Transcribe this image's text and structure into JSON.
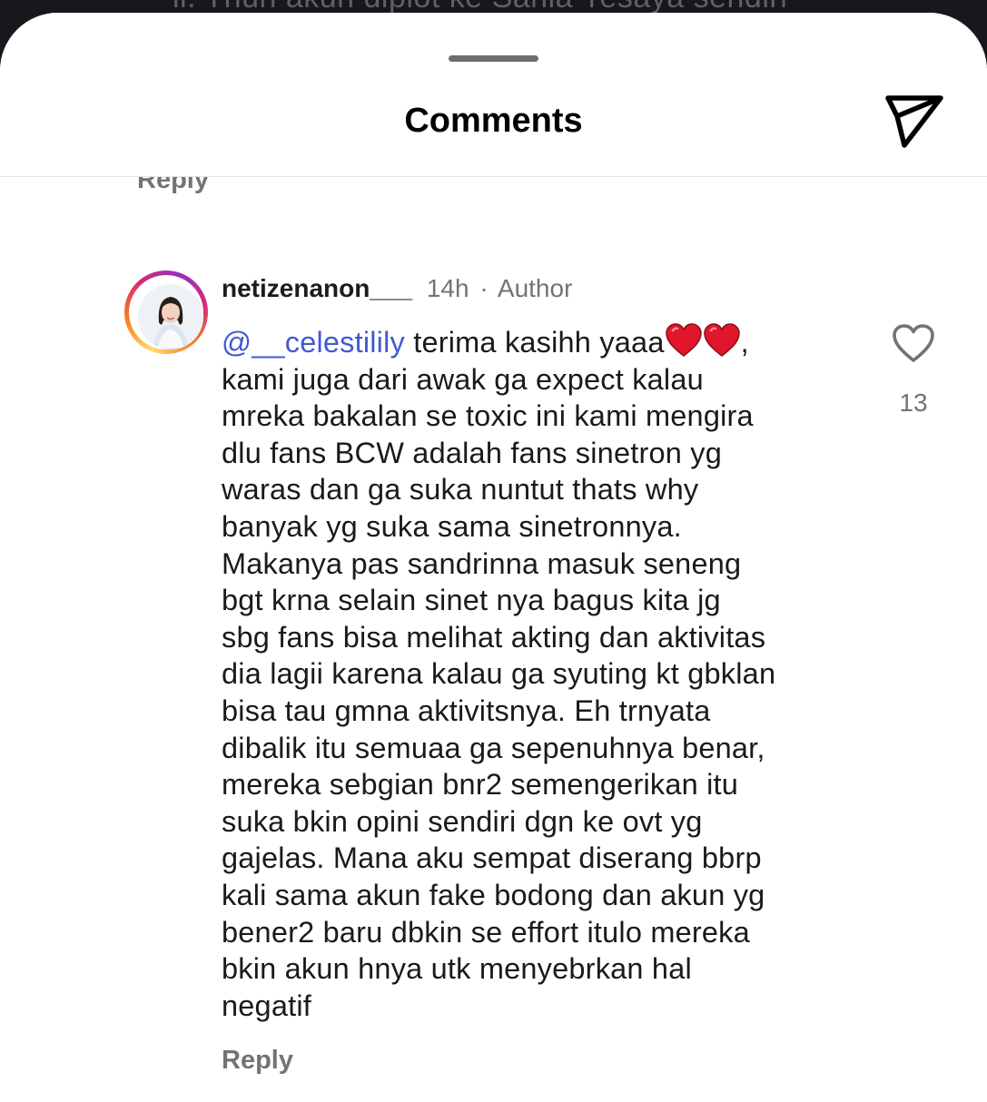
{
  "background": {
    "partial_text": "ii. Thun akun diplot ke Sania Yesaya sendiri"
  },
  "header": {
    "title": "Comments"
  },
  "previous_comment": {
    "reply_label": "Reply"
  },
  "comment": {
    "username": "netizenanon___",
    "time": "14h",
    "separator": "·",
    "author_badge": "Author",
    "mention": "@__celestilily",
    "text_line1": " terima kasihh yaaa",
    "text_after_hearts": ",",
    "text_rest": "kami juga dari awak ga expect kalau\nmreka bakalan se toxic ini kami mengira\ndlu fans BCW adalah fans sinetron yg\nwaras dan ga suka nuntut thats why\nbanyak yg suka sama sinetronnya.\nMakanya pas sandrinna masuk seneng\nbgt krna selain sinet nya bagus kita jg\nsbg fans bisa melihat akting dan aktivitas\ndia lagii karena kalau ga syuting kt gbklan\nbisa tau gmna aktivitsnya. Eh trnyata\ndibalik itu semuaa ga sepenuhnya benar,\nmereka sebgian bnr2 semengerikan itu\nsuka bkin opini sendiri dgn ke ovt yg\ngajelas. Mana aku sempat diserang bbrp\nkali sama akun fake bodong dan akun yg\nbener2 baru dbkin se effort itulo mereka\nbkin akun hnya utk menyebrkan hal\nnegatif",
    "emoji": [
      "red-heart",
      "red-heart"
    ],
    "reply_label": "Reply",
    "like_count": "13"
  },
  "colors": {
    "mention": "#4159d6",
    "secondary_text": "#737373",
    "heart": "#e0162b"
  }
}
